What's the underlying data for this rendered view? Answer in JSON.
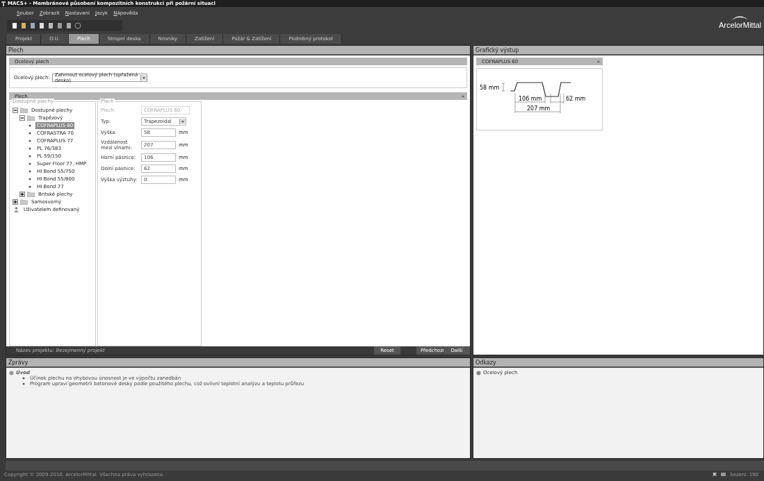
{
  "window": {
    "title": "MACS+ - Membránové působení kompozitních konstrukcí při požární situaci"
  },
  "menu": [
    "Soubor",
    "Zobrazit",
    "Nastavení",
    "Jazyk",
    "Nápověda"
  ],
  "logo": "ArcelorMittal",
  "tabs": [
    {
      "label": "Projekt",
      "selected": false
    },
    {
      "label": "O.U.",
      "selected": false
    },
    {
      "label": "Plech",
      "selected": true
    },
    {
      "label": "Stropní deska",
      "selected": false
    },
    {
      "label": "Nosníky",
      "selected": false
    },
    {
      "label": "Zatížení",
      "selected": false
    },
    {
      "label": "Požár & Zatížení",
      "selected": false
    },
    {
      "label": "Podrobný protokol",
      "selected": false
    }
  ],
  "main": {
    "title": "Plech",
    "steel_section": {
      "title": "Ocelový plech",
      "label": "Ocelový plech:",
      "value": "Zahrnout ocelový plech (spřažená deska)"
    },
    "sheet_section": {
      "title": "Plech",
      "collapse": "«",
      "tree_title": "Dostupné plechy",
      "tree": [
        {
          "label": "Dostupné plechy",
          "kind": "folder",
          "expanded": true,
          "children": [
            {
              "label": "Trapézový",
              "kind": "folder",
              "expanded": true,
              "children": [
                {
                  "label": "COFRAPLUS 60",
                  "kind": "leaf",
                  "selected": true
                },
                {
                  "label": "COFRASTRA 70",
                  "kind": "leaf",
                  "selected": false
                },
                {
                  "label": "COFRAPLUS 77",
                  "kind": "leaf",
                  "selected": false
                },
                {
                  "label": "PL 76/383",
                  "kind": "leaf",
                  "selected": false
                },
                {
                  "label": "PL 59/150",
                  "kind": "leaf",
                  "selected": false
                },
                {
                  "label": "Super Floor 77, HMP",
                  "kind": "leaf",
                  "selected": false
                },
                {
                  "label": "HI Bond 55/750",
                  "kind": "leaf",
                  "selected": false
                },
                {
                  "label": "HI Bond 55/800",
                  "kind": "leaf",
                  "selected": false
                },
                {
                  "label": "HI Bond 77",
                  "kind": "leaf",
                  "selected": false
                }
              ]
            },
            {
              "label": "Britské plechy",
              "kind": "folder",
              "expanded": false
            }
          ]
        },
        {
          "label": "Samosvorný",
          "kind": "folder",
          "expanded": false
        },
        {
          "label": "Uživatelem definovaný",
          "kind": "user"
        }
      ],
      "details_title": "Plech",
      "fields": [
        {
          "label": "Plech:",
          "value": "COFRAPLUS 60",
          "kind": "text",
          "disabled": true
        },
        {
          "label": "Typ:",
          "value": "Trapezoidal",
          "kind": "select",
          "disabled": false
        },
        {
          "label": "Výška:",
          "value": "58",
          "unit": "mm",
          "kind": "text",
          "disabled": false
        },
        {
          "label": "Vzdálenost mezi vlnami:",
          "value": "207",
          "unit": "mm",
          "kind": "text",
          "disabled": false
        },
        {
          "label": "Horní pásnice:",
          "value": "106",
          "unit": "mm",
          "kind": "text",
          "disabled": false
        },
        {
          "label": "Dolní pásnice:",
          "value": "62",
          "unit": "mm",
          "kind": "text",
          "disabled": false
        },
        {
          "label": "Výška výztuhy:",
          "value": "0",
          "unit": "mm",
          "kind": "text",
          "disabled": false
        }
      ]
    },
    "footer": {
      "project_label": "Název projektu:",
      "project_name": "Bezejmenný projekt",
      "buttons": [
        "Reset",
        "Předchozí",
        "Další"
      ]
    }
  },
  "graphic": {
    "title": "Grafický výstup",
    "section": "COFRAPLUS 60",
    "collapse": "«",
    "dims": {
      "height": "58 mm",
      "top": "106 mm",
      "bottom": "62 mm",
      "pitch": "207 mm"
    }
  },
  "messages": {
    "title": "Zprávy",
    "heading": "Úvod",
    "items": [
      "Účinek plechu na ohybovou únosnost je ve výpočtu zanedbán",
      "Program upraví geometrii betonové desky podle použitého plechu, což ovlivní teplotní analýzu a teplotu průřezu"
    ]
  },
  "links": {
    "title": "Odkazy",
    "items": [
      "Ocelový plech"
    ]
  },
  "status_bar": {
    "copyright": "Copyright © 2009-2010. ArcelorMittal. Všechna práva vyhrazena.",
    "session": "Sezení: 190"
  }
}
